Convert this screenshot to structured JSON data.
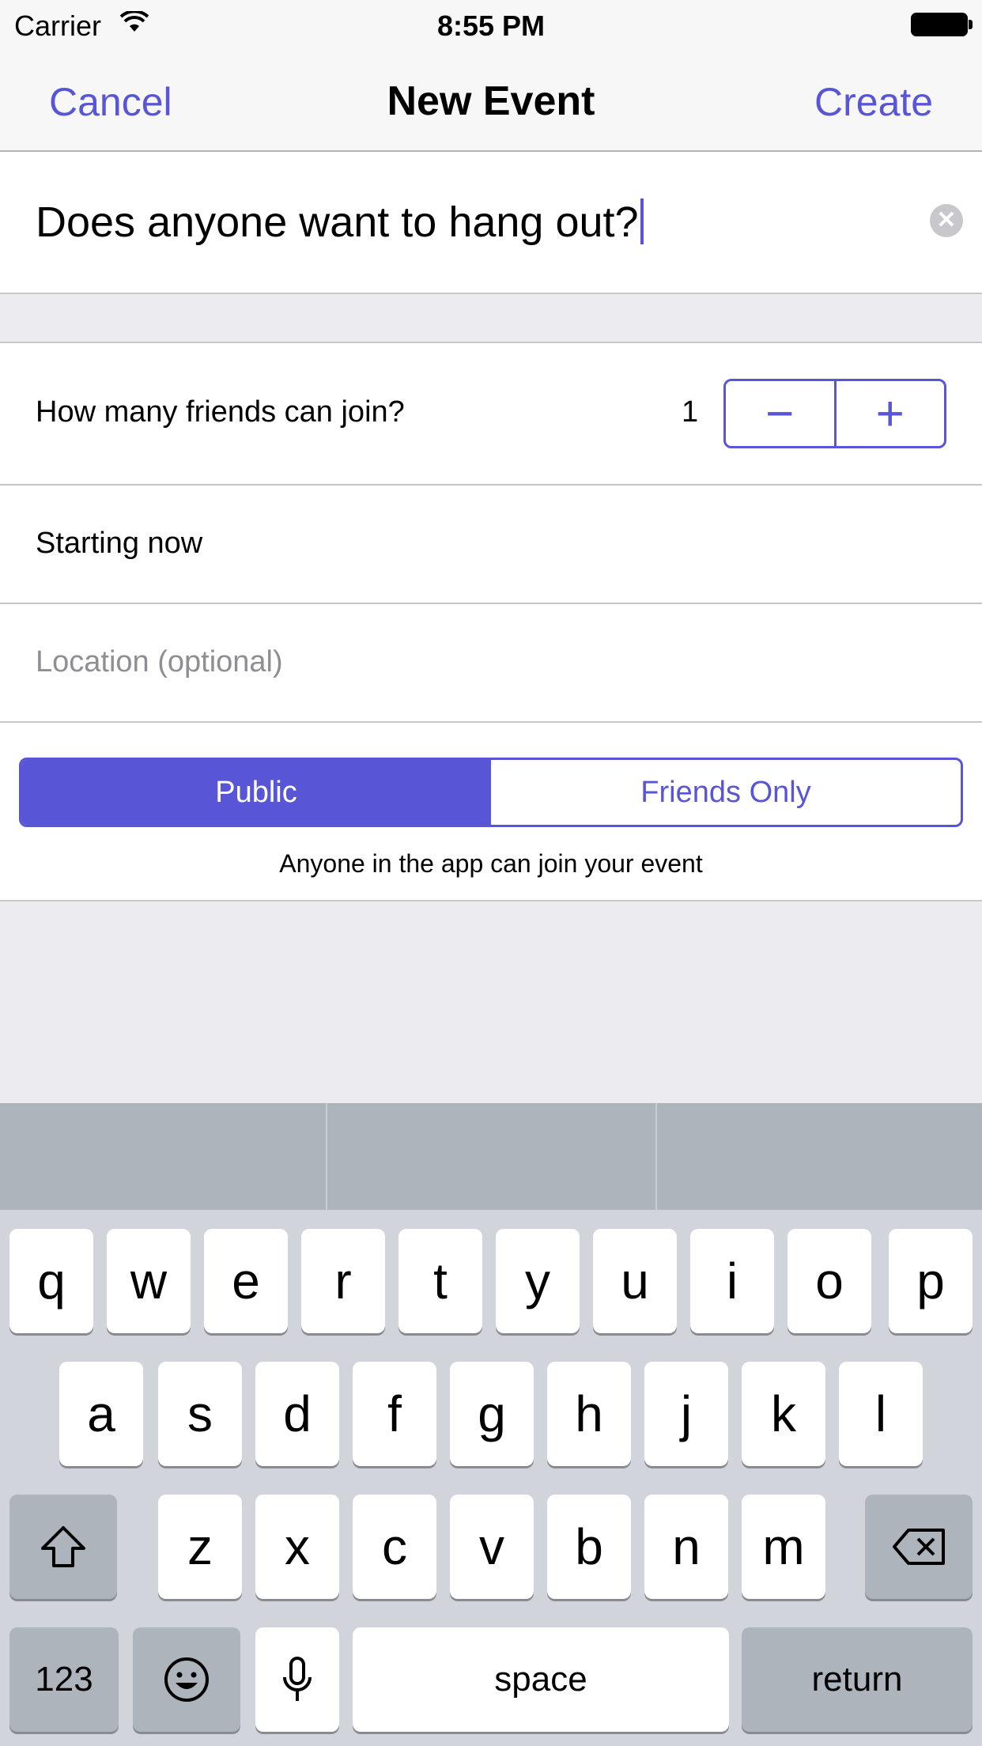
{
  "status_bar": {
    "carrier": "Carrier",
    "time": "8:55 PM"
  },
  "nav": {
    "cancel_label": "Cancel",
    "title": "New Event",
    "create_label": "Create"
  },
  "event_title": {
    "value": "Does anyone want to hang out?",
    "clear_glyph": "✕"
  },
  "friends": {
    "label": "How many friends can join?",
    "count": "1",
    "decrement": "−",
    "increment": "+"
  },
  "start": {
    "label": "Starting now"
  },
  "location": {
    "placeholder": "Location (optional)"
  },
  "visibility": {
    "options": [
      "Public",
      "Friends Only"
    ],
    "selected": "Public",
    "caption": "Anyone in the app can join your event"
  },
  "keyboard": {
    "row1": [
      "q",
      "w",
      "e",
      "r",
      "t",
      "y",
      "u",
      "i",
      "o",
      "p"
    ],
    "row2": [
      "a",
      "s",
      "d",
      "f",
      "g",
      "h",
      "j",
      "k",
      "l"
    ],
    "row3": [
      "z",
      "x",
      "c",
      "v",
      "b",
      "n",
      "m"
    ],
    "numbers_label": "123",
    "space_label": "space",
    "return_label": "return",
    "icons": [
      "shift-icon",
      "backspace-icon",
      "emoji-icon",
      "microphone-icon"
    ]
  },
  "colors": {
    "accent": "#5856d6",
    "separator": "#c8c7cc",
    "background": "#ebebf0",
    "keyboard": "#d1d5db"
  }
}
